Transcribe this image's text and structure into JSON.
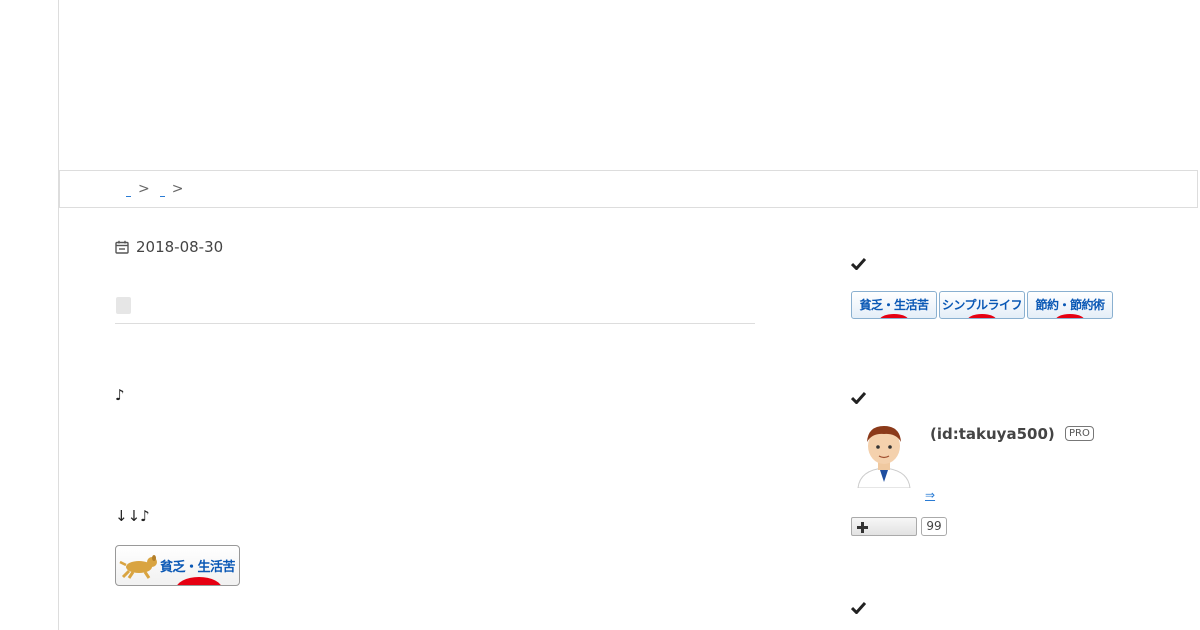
{
  "breadcrumb": {
    "separator": ">"
  },
  "article": {
    "date": "2018-08-30",
    "note_1": "♪",
    "note_2": "↓↓♪",
    "banner_label": "貧乏・生活苦"
  },
  "sidebar": {
    "ranking_banners": [
      {
        "label": "貧乏・生活苦"
      },
      {
        "label": "シンプルライフ"
      },
      {
        "label": "節約・節約術"
      }
    ],
    "profile": {
      "id_text": "(id:takuya500)",
      "badge": "PRO",
      "link_glyph": "⇒",
      "subscriber_count": "99"
    }
  },
  "colors": {
    "link_blue": "#2a7bd4",
    "banner_blue": "#0a58b5",
    "banner_red": "#e60012",
    "border_gray": "#dddddd"
  },
  "icons": [
    "calendar-icon",
    "check-icon",
    "plus-icon",
    "dog-icon",
    "avatar"
  ]
}
